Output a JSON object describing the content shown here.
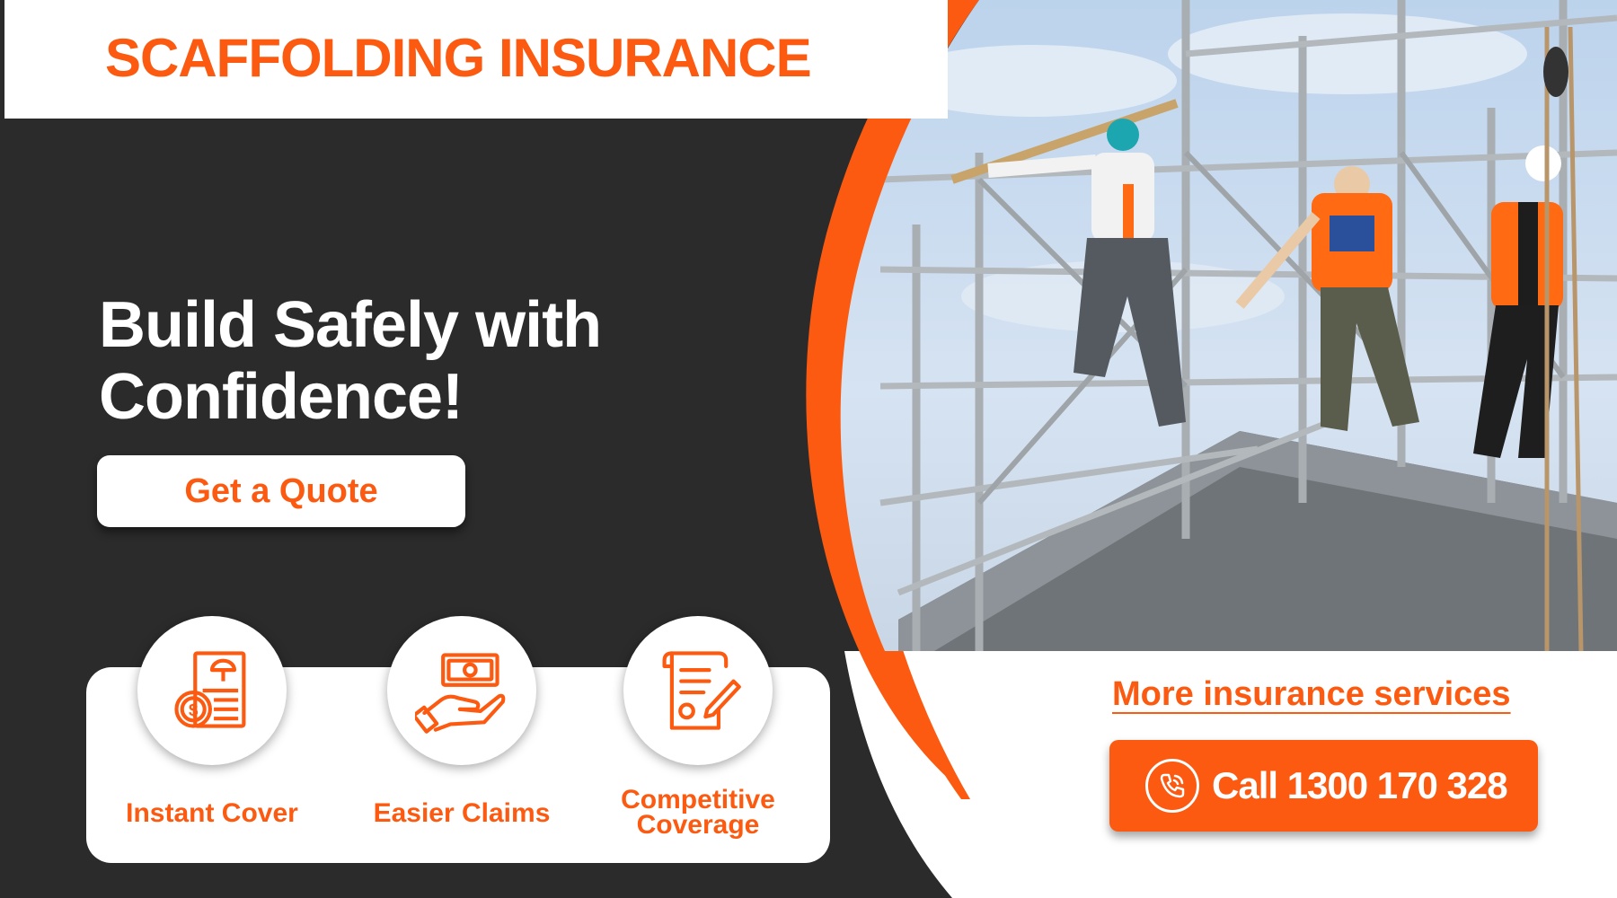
{
  "banner": {
    "title": "SCAFFOLDING INSURANCE",
    "headline_line1": "Build Safely with",
    "headline_line2": "Confidence!",
    "quote_button": "Get a Quote"
  },
  "features": [
    {
      "label": "Instant Cover",
      "icon": "insurance-policy-icon"
    },
    {
      "label": "Easier Claims",
      "icon": "money-hand-icon"
    },
    {
      "label_line1": "Competitive",
      "label_line2": "Coverage",
      "icon": "certificate-document-icon"
    }
  ],
  "links": {
    "more_services": "More insurance services",
    "call_label": "Call 1300 170 328"
  },
  "photo": {
    "description_icon": "scaffolding-workers-photo"
  },
  "colors": {
    "accent": "#fb5a10",
    "dark": "#2b2b2b",
    "white": "#ffffff"
  }
}
